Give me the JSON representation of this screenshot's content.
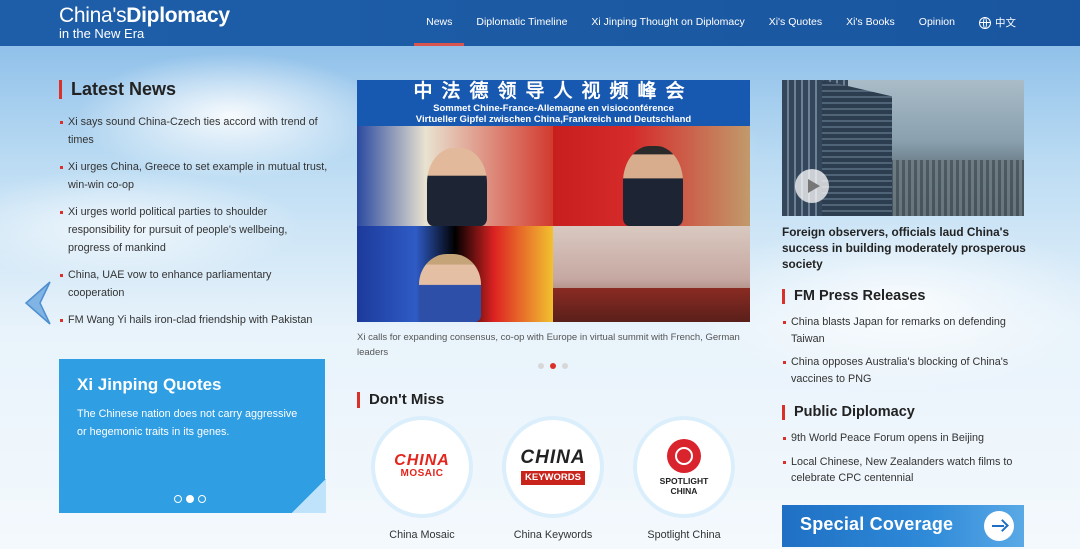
{
  "header": {
    "logo_line1_a": "China's",
    "logo_line1_b": "Diplomacy",
    "logo_line2": "in the New Era",
    "nav": [
      {
        "label": "News",
        "active": true
      },
      {
        "label": "Diplomatic Timeline"
      },
      {
        "label": "Xi Jinping Thought on Diplomacy"
      },
      {
        "label": "Xi's Quotes"
      },
      {
        "label": "Xi's Books"
      },
      {
        "label": "Opinion"
      },
      {
        "label": "中文"
      }
    ]
  },
  "latest_news": {
    "title": "Latest News",
    "items": [
      "Xi says sound China-Czech ties accord with trend of times",
      "Xi urges China, Greece to set example in mutual trust, win-win co-op",
      "Xi urges world political parties to shoulder responsibility for pursuit of people's wellbeing, progress of mankind",
      "China, UAE vow to enhance parliamentary cooperation",
      "FM Wang Yi hails iron-clad friendship with Pakistan"
    ]
  },
  "quotes": {
    "title": "Xi Jinping Quotes",
    "body": "The Chinese nation does not carry aggressive or hegemonic traits in its genes.",
    "current_slide": 2,
    "total_slides": 3
  },
  "main_story": {
    "banner_zh": "中法德领导人视频峰会",
    "banner_fr": "Sommet Chine-France-Allemagne en visioconférence",
    "banner_de": "Virtueller Gipfel zwischen China,Frankreich und Deutschland",
    "caption": "Xi calls for expanding consensus, co-op with Europe in virtual summit with French, German leaders",
    "current_slide": 2,
    "total_slides": 3
  },
  "dont_miss": {
    "title": "Don't Miss",
    "items": [
      {
        "label": "China Mosaic",
        "logo_a": "CHINA",
        "logo_b": "MOSAIC"
      },
      {
        "label": "China Keywords",
        "logo_a": "CHINA",
        "logo_b": "KEYWORDS"
      },
      {
        "label": "Spotlight China",
        "logo_a": "SPOTLIGHT",
        "logo_b": "CHINA"
      }
    ]
  },
  "video": {
    "caption": "Foreign observers, officials laud China's success in building moderately prosperous society"
  },
  "fm_press": {
    "title": "FM Press Releases",
    "items": [
      "China blasts Japan for remarks on defending Taiwan",
      "China opposes Australia's blocking of China's vaccines to PNG"
    ]
  },
  "public_diplomacy": {
    "title": "Public Diplomacy",
    "items": [
      "9th World Peace Forum opens in Beijing",
      "Local Chinese, New Zealanders watch films to celebrate CPC centennial"
    ]
  },
  "special": {
    "label": "Special Coverage"
  },
  "colors": {
    "header": "#1e5ea8",
    "accent": "#d9312a",
    "quotes_bg": "#2f9ee3"
  }
}
